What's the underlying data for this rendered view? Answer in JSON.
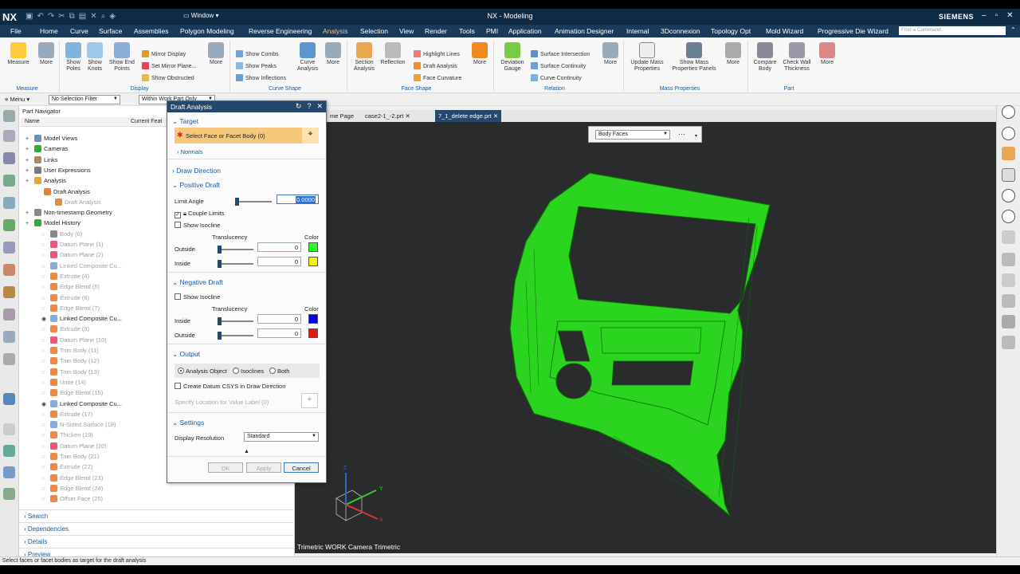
{
  "app": {
    "logo": "NX",
    "window_menu": "Window",
    "title": "NX - Modeling",
    "brand": "SIEMENS"
  },
  "menu": {
    "items": [
      "File",
      "Home",
      "Curve",
      "Surface",
      "Assemblies",
      "Polygon Modeling",
      "Reverse Engineering",
      "Analysis",
      "Selection",
      "View",
      "Render",
      "Tools",
      "PMI",
      "Application",
      "Animation Designer",
      "Internal",
      "3Dconnexion",
      "Topology Opt",
      "Mold Wizard",
      "Progressive Die Wizard"
    ],
    "active": "Analysis",
    "find_placeholder": "Find a Command"
  },
  "ribbon": {
    "measure": "Measure",
    "more": "More",
    "show_poles": "Show Poles",
    "show_knots": "Show Knots",
    "show_end_points": "Show End Points",
    "mirror_display": "Mirror Display",
    "set_mirror_plane": "Set Mirror Plane...",
    "show_obstructed": "Show Obstructed",
    "show_combs": "Show Combs",
    "show_peaks": "Show Peaks",
    "show_inflections": "Show Inflections",
    "curve_analysis": "Curve Analysis",
    "section_analysis": "Section Analysis",
    "reflection": "Reflection",
    "highlight_lines": "Highlight Lines",
    "draft_analysis": "Draft Analysis",
    "face_curvature": "Face Curvature",
    "deviation_gauge": "Deviation Gauge",
    "surface_intersection": "Surface Intersection",
    "surface_continuity": "Surface Continuity",
    "curve_continuity": "Curve Continuity",
    "update_mass_properties": "Update Mass Properties",
    "show_mass_properties_panels": "Show Mass Properties Panels",
    "compare_body": "Compare Body",
    "check_wall_thickness": "Check Wall Thickness",
    "groups": {
      "measure": "Measure",
      "display": "Display",
      "curve_shape": "Curve Shape",
      "face_shape": "Face Shape",
      "relation": "Relation",
      "mass_properties": "Mass Properties",
      "part": "Part"
    }
  },
  "filterbar": {
    "menu": "Menu",
    "selection_filter": "No Selection Filter",
    "scope": "Within Work Part Only"
  },
  "part_navigator": {
    "title": "Part Navigator",
    "col_name": "Name",
    "col_feature": "Current Feat",
    "rows": [
      {
        "label": "Model Views",
        "dim": false
      },
      {
        "label": "Cameras",
        "dim": false
      },
      {
        "label": "Links",
        "dim": false
      },
      {
        "label": "User Expressions",
        "dim": false
      },
      {
        "label": "Analysis",
        "dim": false
      },
      {
        "label": "Draft Analysis",
        "dim": false
      },
      {
        "label": "Draft Analysis",
        "dim": true
      },
      {
        "label": "Non-timestamp Geometry",
        "dim": false
      },
      {
        "label": "Model History",
        "dim": false
      },
      {
        "label": "Body (0)",
        "dim": true
      },
      {
        "label": "Datum Plane (1)",
        "dim": true
      },
      {
        "label": "Datum Plane (2)",
        "dim": true
      },
      {
        "label": "Linked Composite Cu...",
        "dim": true
      },
      {
        "label": "Extrude (4)",
        "dim": true
      },
      {
        "label": "Edge Blend (5)",
        "dim": true
      },
      {
        "label": "Extrude (6)",
        "dim": true
      },
      {
        "label": "Edge Blend (7)",
        "dim": true
      },
      {
        "label": "Linked Composite Cu...",
        "dim": false
      },
      {
        "label": "Extrude (9)",
        "dim": true
      },
      {
        "label": "Datum Plane (10)",
        "dim": true
      },
      {
        "label": "Trim Body (11)",
        "dim": true
      },
      {
        "label": "Trim Body (12)",
        "dim": true
      },
      {
        "label": "Trim Body (13)",
        "dim": true
      },
      {
        "label": "Unite (14)",
        "dim": true
      },
      {
        "label": "Edge Blend (15)",
        "dim": true
      },
      {
        "label": "Linked Composite Cu...",
        "dim": false
      },
      {
        "label": "Extrude (17)",
        "dim": true
      },
      {
        "label": "N-Sided Surface (18)",
        "dim": true
      },
      {
        "label": "Thicken (19)",
        "dim": true
      },
      {
        "label": "Datum Plane (20)",
        "dim": true
      },
      {
        "label": "Trim Body (21)",
        "dim": true
      },
      {
        "label": "Extrude (22)",
        "dim": true
      },
      {
        "label": "Edge Blend (23)",
        "dim": true
      },
      {
        "label": "Edge Blend (24)",
        "dim": true
      },
      {
        "label": "Offset Face (25)",
        "dim": true
      }
    ],
    "sections": [
      "Search",
      "Dependencies",
      "Details",
      "Preview"
    ]
  },
  "dialog": {
    "title": "Draft Analysis",
    "target": "Target",
    "select_face": "Select Face or Facet Body (0)",
    "normals": "Normals",
    "draw_direction": "Draw Direction",
    "positive_draft": "Positive Draft",
    "limit_angle": "Limit Angle",
    "limit_angle_value": "0.0000",
    "couple_limits": "Couple Limits",
    "show_isocline": "Show Isocline",
    "translucency": "Translucency",
    "color": "Color",
    "outside": "Outside",
    "inside": "Inside",
    "pos_outside_value": "0",
    "pos_inside_value": "0",
    "negative_draft": "Negative Draft",
    "neg_inside_value": "0",
    "neg_outside_value": "0",
    "output": "Output",
    "analysis_object": "Analysis Object",
    "isoclines": "Isoclines",
    "both": "Both",
    "create_datum_csys": "Create Datum CSYS in Draw Direction",
    "specify_location": "Specify Location for Value Label (0)",
    "settings": "Settings",
    "display_resolution": "Display Resolution",
    "display_resolution_value": "Standard",
    "ok": "OK",
    "apply": "Apply",
    "cancel": "Cancel"
  },
  "colors": {
    "pos_outside": "#22ff22",
    "pos_inside": "#f4f40a",
    "neg_inside": "#0000ee",
    "neg_outside": "#ee1111",
    "model": "#2bd51f"
  },
  "tabs": [
    {
      "label": "me Page",
      "active": false
    },
    {
      "label": "case2-1_-2.prt",
      "active": false
    },
    {
      "label": "7_1_delete edge.prt",
      "active": true
    }
  ],
  "viewport": {
    "type_filter": "Body Faces",
    "camera_label": "Trimetric WORK Camera Trimetric"
  },
  "status": "Select faces or facet bodies as target for the draft analysis"
}
